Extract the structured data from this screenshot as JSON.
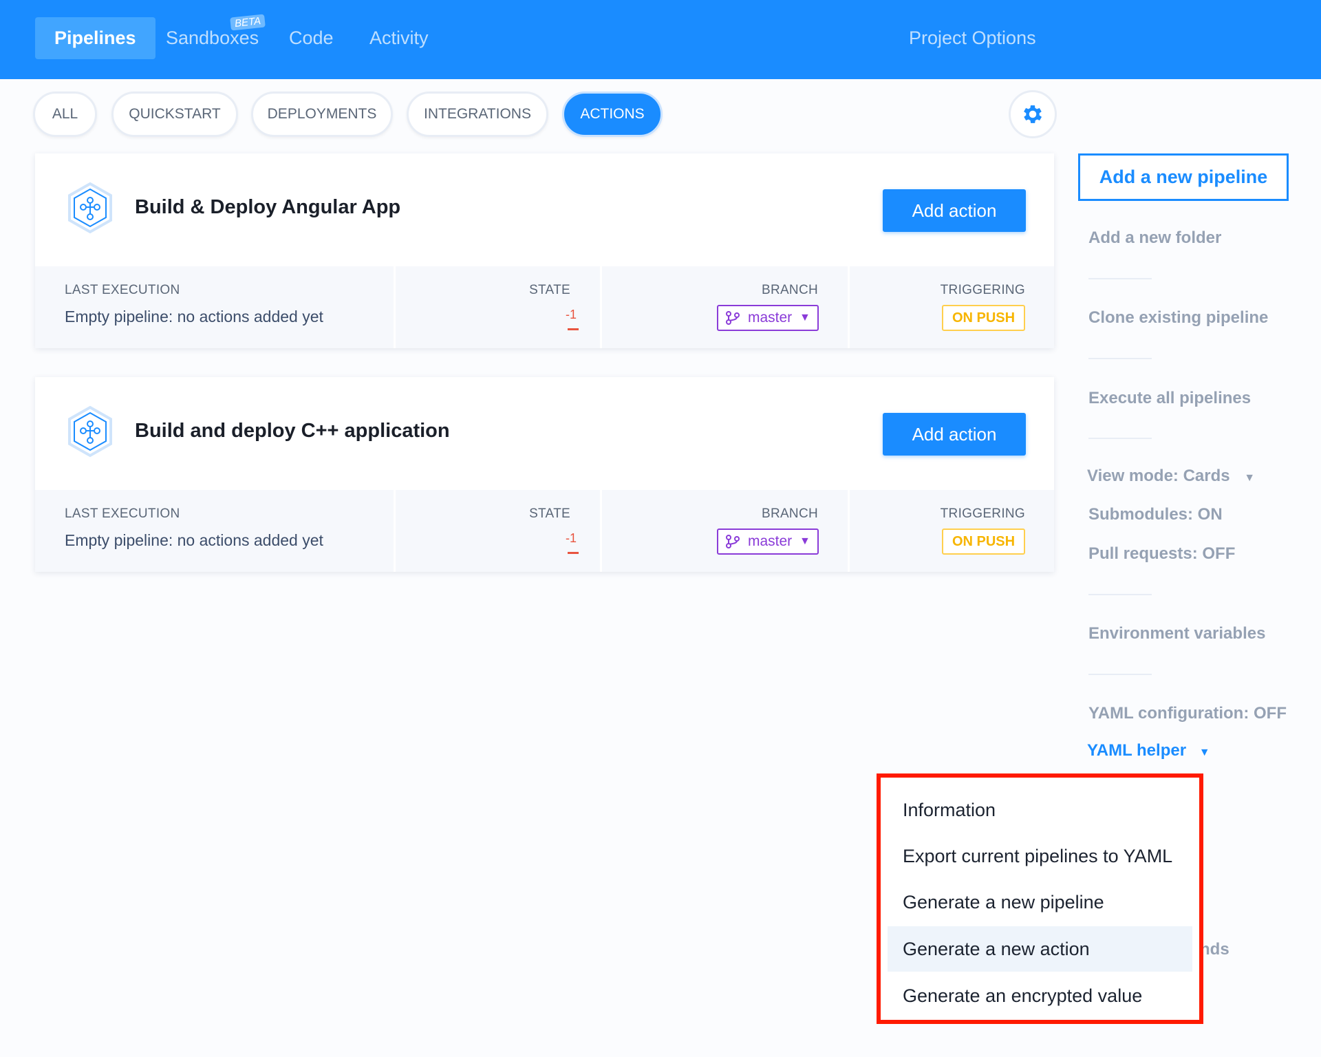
{
  "nav": {
    "tabs": [
      {
        "label": "Pipelines",
        "active": true
      },
      {
        "label": "Sandboxes",
        "badge": "BETA"
      },
      {
        "label": "Code"
      },
      {
        "label": "Activity"
      }
    ],
    "project_options": "Project Options"
  },
  "filters": [
    "ALL",
    "QUICKSTART",
    "DEPLOYMENTS",
    "INTEGRATIONS",
    "ACTIONS"
  ],
  "active_filter": "ACTIONS",
  "columns": {
    "last_execution": "LAST EXECUTION",
    "state": "STATE",
    "branch": "BRANCH",
    "triggering": "TRIGGERING"
  },
  "pipelines": [
    {
      "name": "Build & Deploy Angular App",
      "add_action": "Add action",
      "last_execution": "Empty pipeline: no actions added yet",
      "state": "-1",
      "branch": "master",
      "triggering": "ON PUSH"
    },
    {
      "name": "Build and deploy C++ application",
      "add_action": "Add action",
      "last_execution": "Empty pipeline: no actions added yet",
      "state": "-1",
      "branch": "master",
      "triggering": "ON PUSH"
    }
  ],
  "sidebar": {
    "add_pipeline": "Add a new pipeline",
    "add_folder": "Add a new folder",
    "clone": "Clone existing pipeline",
    "execute_all": "Execute all pipelines",
    "view_mode": "View mode: Cards",
    "submodules": "Submodules: ON",
    "pull_requests": "Pull requests: OFF",
    "env_vars": "Environment variables",
    "yaml_config": "YAML configuration: OFF",
    "yaml_helper": "YAML helper",
    "hidden_partial": "nds"
  },
  "yaml_menu": {
    "items": [
      "Information",
      "Export current pipelines to YAML",
      "Generate a new pipeline",
      "Generate a new action",
      "Generate an encrypted value"
    ],
    "highlighted": "Generate a new action"
  },
  "colors": {
    "primary": "#1a8cff",
    "branch": "#8a3bd8",
    "trigger": "#f7b500",
    "state": "#e8543f",
    "highlight_box": "#ff1a00"
  }
}
